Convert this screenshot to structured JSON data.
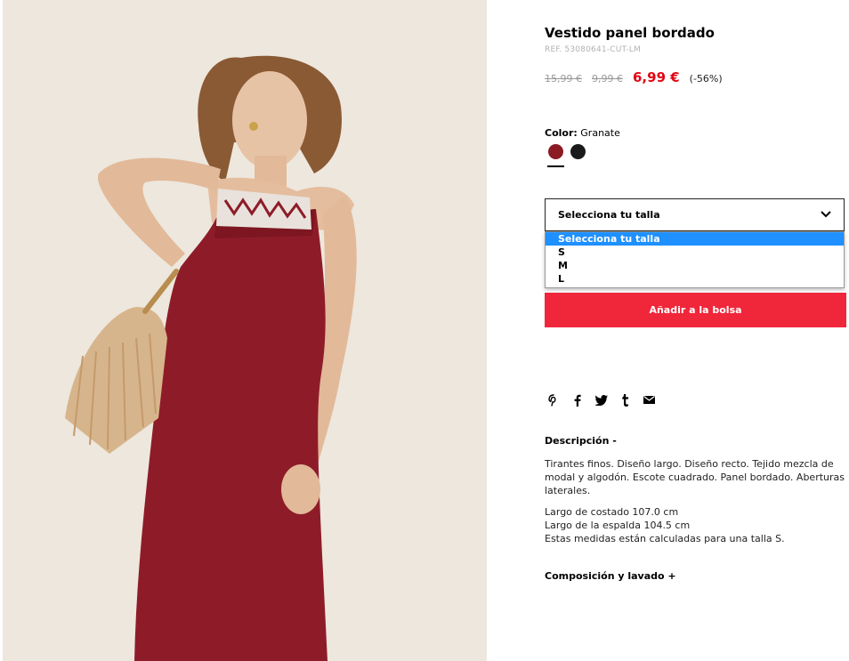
{
  "product": {
    "title": "Vestido panel bordado",
    "ref": "REF. 53080641-CUT-LM",
    "price_original": "15,99 €",
    "price_previous": "9,99 €",
    "price_current": "6,99 €",
    "discount": "(-56%)"
  },
  "color": {
    "label": "Color:",
    "selected_name": "Granate",
    "swatches": [
      {
        "name": "Granate",
        "hex": "#8b1a24",
        "selected": true
      },
      {
        "name": "Negro",
        "hex": "#1a1a1a",
        "selected": false
      }
    ]
  },
  "size_select": {
    "value": "Selecciona tu talla",
    "options": [
      "Selecciona tu talla",
      "S",
      "M",
      "L"
    ],
    "highlighted_index": 0
  },
  "actions": {
    "add_to_bag": "Añadir a la bolsa"
  },
  "social_icons": [
    "pinterest-icon",
    "facebook-icon",
    "twitter-icon",
    "tumblr-icon",
    "email-icon"
  ],
  "description": {
    "heading": "Descripción -",
    "paragraph": "Tirantes finos. Diseño largo. Diseño recto. Tejido mezcla de modal y algodón. Escote cuadrado. Panel bordado. Aberturas laterales.",
    "measure_1": "Largo de costado 107.0 cm",
    "measure_2": "Largo de la espalda 104.5 cm",
    "measure_note": "Estas medidas están calculadas para una talla S."
  },
  "composition": {
    "heading": "Composición y lavado +"
  },
  "colors": {
    "accent": "#f0263a",
    "price_red": "#e30613",
    "highlight": "#1e90ff"
  }
}
